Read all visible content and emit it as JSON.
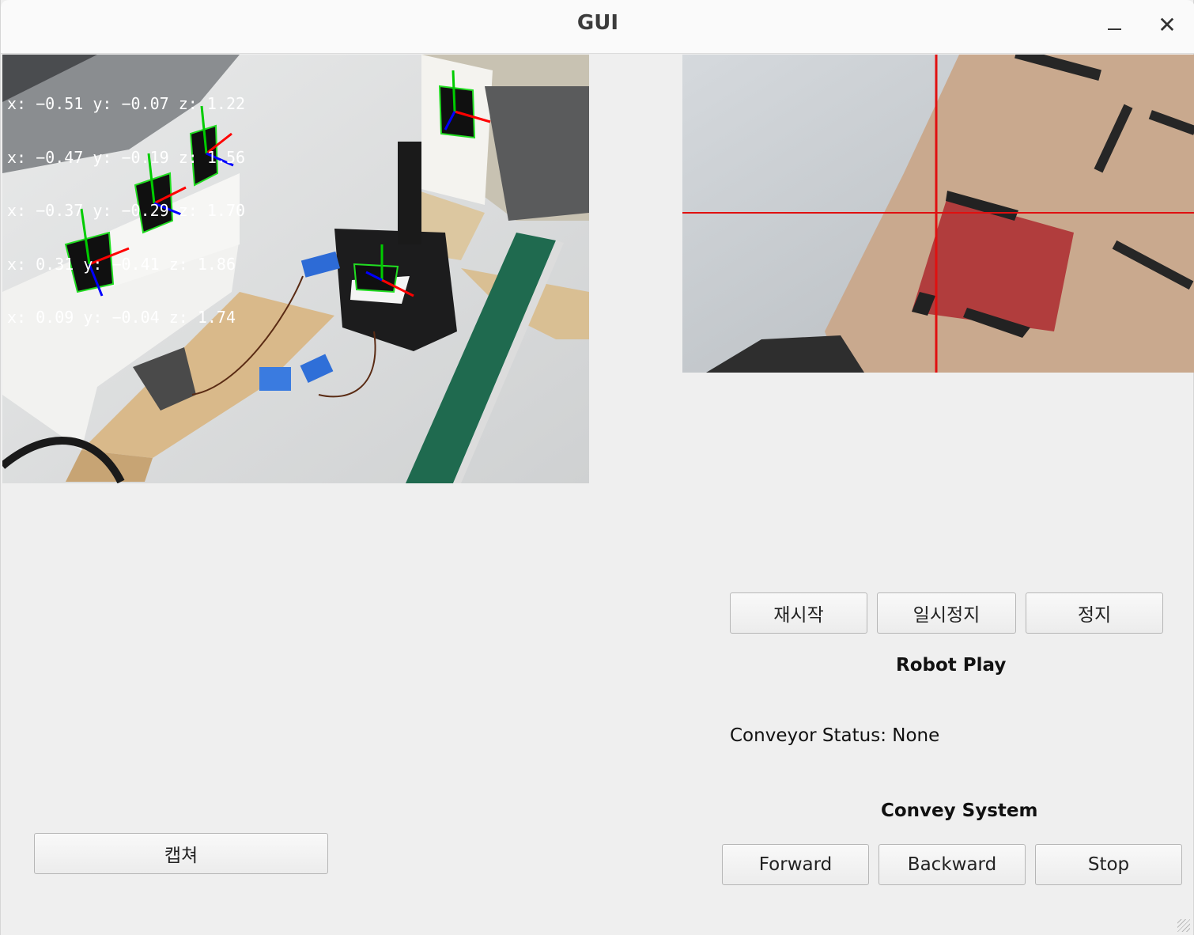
{
  "window": {
    "title": "GUI",
    "minimize_icon": "minimize-icon",
    "close_glyph": "✕"
  },
  "camera_main": {
    "overlay": [
      "x: −0.51 y: −0.07 z: 1.22",
      "x: −0.47 y: −0.19 z: 1.56",
      "x: −0.37 y: −0.29 z: 1.70",
      "x: 0.31 y: −0.41 z: 1.86",
      "x: 0.09 y: −0.04 z: 1.74"
    ]
  },
  "robot_controls": {
    "restart": "재시작",
    "pause": "일시정지",
    "stop": "정지",
    "title": "Robot Play"
  },
  "conveyor": {
    "status": "Conveyor Status: None",
    "title": "Convey System",
    "forward": "Forward",
    "backward": "Backward",
    "stop": "Stop"
  },
  "capture": {
    "label": "캡쳐"
  },
  "colors": {
    "background": "#efefef",
    "crosshair": "#e01010",
    "axis_x": "#ff0000",
    "axis_y": "#00cc00",
    "axis_z": "#0000ff"
  }
}
